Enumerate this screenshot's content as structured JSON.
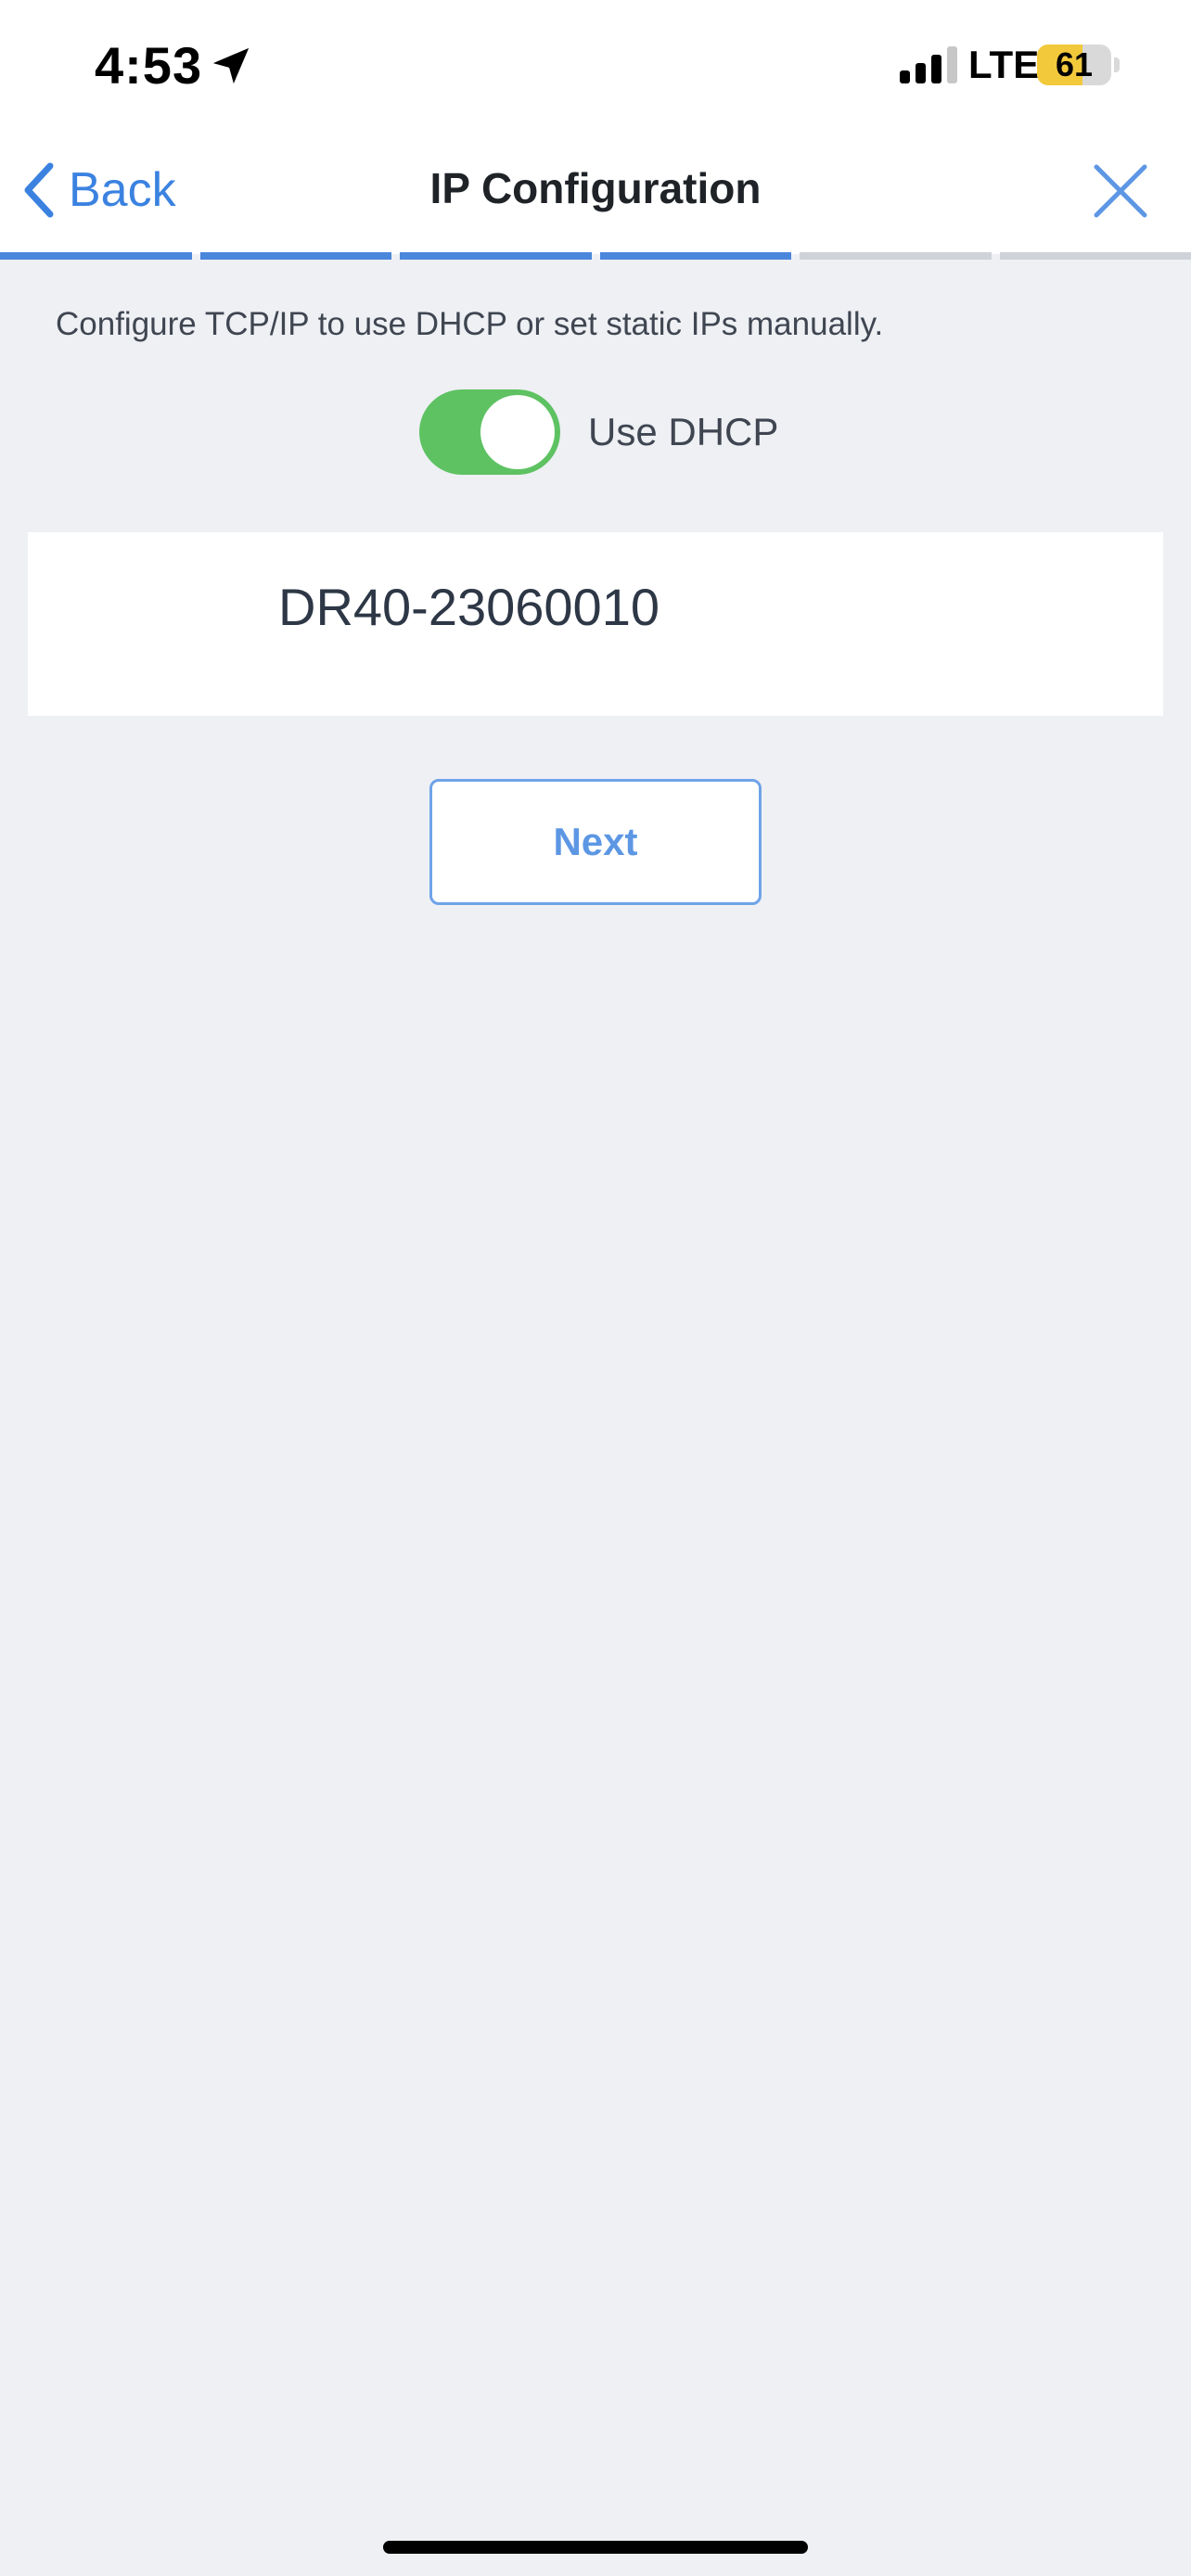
{
  "status_bar": {
    "time": "4:53",
    "network": "LTE",
    "battery_level": "61",
    "battery_fraction": 0.61,
    "battery_color": "#f3c93c",
    "icons": [
      "location-arrow-icon",
      "cellular-signal-icon",
      "battery-icon"
    ]
  },
  "nav": {
    "back_label": "Back",
    "title": "IP Configuration",
    "icons": [
      "chevron-left-icon",
      "close-icon"
    ],
    "accent_color": "#3b82e0"
  },
  "progress": {
    "total_steps": 6,
    "completed_steps": 4,
    "done_color": "#4a86dc",
    "pending_color": "#cfd3d9"
  },
  "content": {
    "description": "Configure TCP/IP to use DHCP or set static IPs manually.",
    "dhcp_toggle": {
      "label": "Use DHCP",
      "on": true,
      "on_color": "#5ec262"
    },
    "device_name": "DR40-23060010",
    "next_label": "Next"
  }
}
